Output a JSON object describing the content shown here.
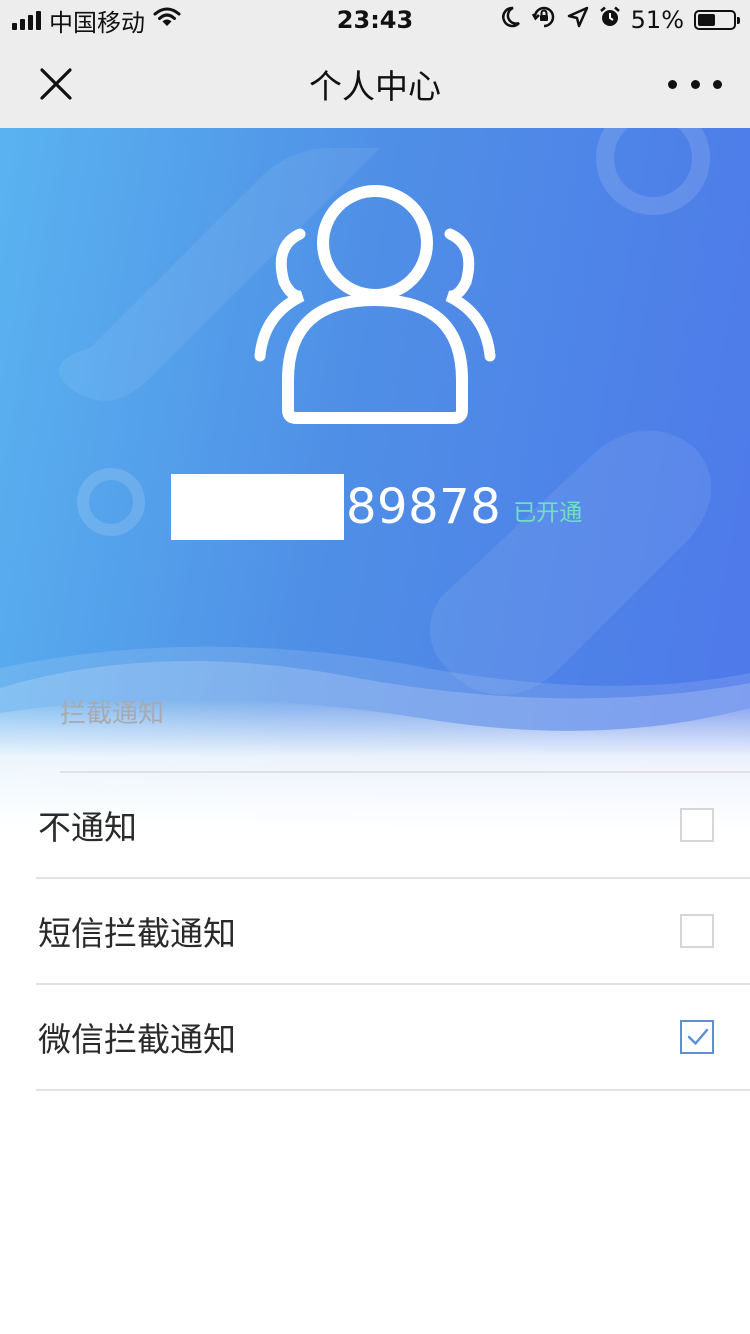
{
  "status_bar": {
    "carrier": "中国移动",
    "time": "23:43",
    "battery_percent": "51%",
    "battery_level": 0.51,
    "icons": [
      "signal-bars-icon",
      "wifi-icon",
      "moon-icon",
      "orientation-lock-icon",
      "location-arrow-icon",
      "alarm-icon",
      "battery-icon"
    ]
  },
  "nav": {
    "title": "个人中心",
    "close_icon": "close-icon",
    "more_icon": "more-dots-icon"
  },
  "profile": {
    "avatar_icon": "users-icon",
    "phone_suffix": "89878",
    "status": "已开通",
    "status_color": "#6fe0c4",
    "hero_gradient": [
      "#5ab3f0",
      "#4f8fe6",
      "#4e78ea"
    ]
  },
  "section": {
    "label": "拦截通知"
  },
  "options": [
    {
      "label": "不通知",
      "checked": false
    },
    {
      "label": "短信拦截通知",
      "checked": false
    },
    {
      "label": "微信拦截通知",
      "checked": true
    }
  ],
  "colors": {
    "checkbox_checked": "#5b8fd8",
    "checkbox_unchecked": "#d6d6d6",
    "divider": "#e1e1e1"
  }
}
